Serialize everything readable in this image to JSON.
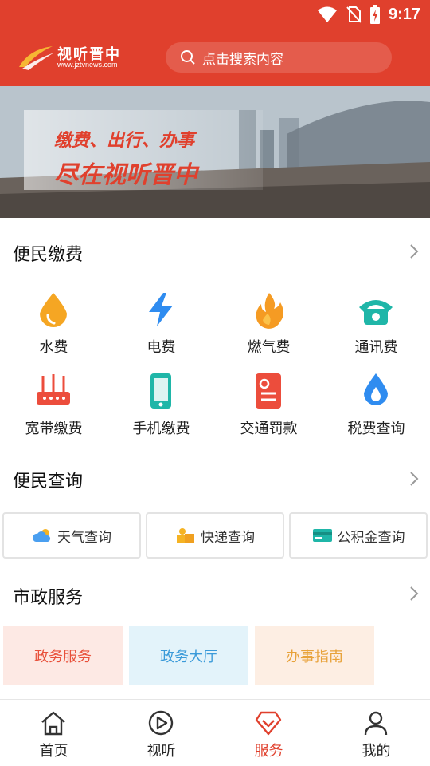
{
  "status_bar": {
    "time": "9:17"
  },
  "header": {
    "logo_text": "视听晋中",
    "logo_url": "www.jztvnews.com",
    "search_placeholder": "点击搜索内容"
  },
  "banner": {
    "line1": "缴费、出行、办事",
    "line2": "尽在视听晋中"
  },
  "payment": {
    "title": "便民缴费",
    "items": [
      {
        "label": "水费",
        "icon": "water-drop-icon"
      },
      {
        "label": "电费",
        "icon": "lightning-icon"
      },
      {
        "label": "燃气费",
        "icon": "flame-icon"
      },
      {
        "label": "通讯费",
        "icon": "telephone-icon"
      },
      {
        "label": "宽带缴费",
        "icon": "router-icon"
      },
      {
        "label": "手机缴费",
        "icon": "mobile-phone-icon"
      },
      {
        "label": "交通罚款",
        "icon": "ticket-icon"
      },
      {
        "label": "税费查询",
        "icon": "tax-drop-icon"
      }
    ]
  },
  "query": {
    "title": "便民查询",
    "items": [
      {
        "label": "天气查询",
        "icon": "weather-icon"
      },
      {
        "label": "快递查询",
        "icon": "delivery-icon"
      },
      {
        "label": "公积金查询",
        "icon": "card-icon"
      }
    ]
  },
  "municipal": {
    "title": "市政服务",
    "cards": [
      {
        "label": "政务服务",
        "color": "#e8503a",
        "bg": "#fde9e4"
      },
      {
        "label": "政务大厅",
        "color": "#3a9ad9",
        "bg": "#e3f3fa"
      },
      {
        "label": "办事指南",
        "color": "#e8a23a",
        "bg": "#fdeee3"
      }
    ]
  },
  "tabbar": {
    "active_color": "#e0402d",
    "tabs": [
      {
        "label": "首页",
        "icon": "home-icon"
      },
      {
        "label": "视听",
        "icon": "play-icon"
      },
      {
        "label": "服务",
        "icon": "diamond-icon",
        "active": true
      },
      {
        "label": "我的",
        "icon": "user-icon"
      }
    ]
  }
}
